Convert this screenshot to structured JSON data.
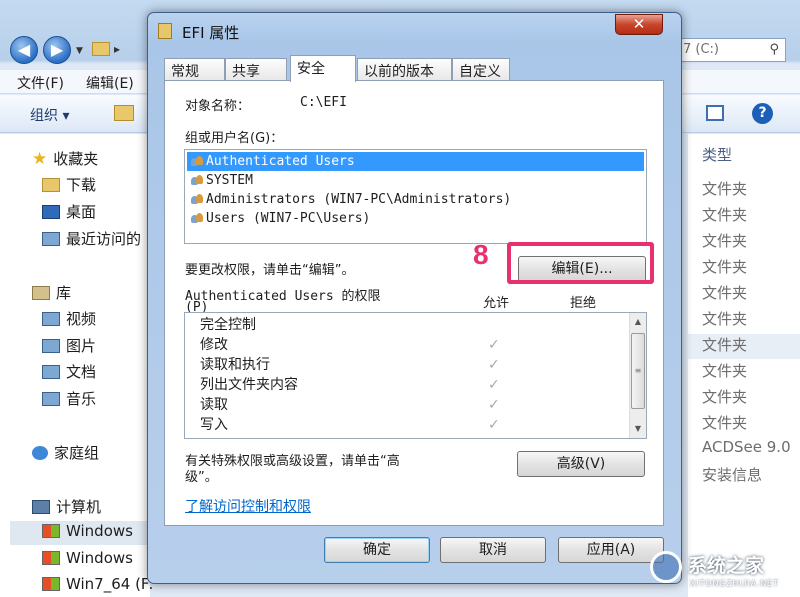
{
  "explorer": {
    "address_tail": "▸",
    "search_box_text": "7 (C:)",
    "menu": [
      "文件(F)",
      "编辑(E)"
    ],
    "toolbar": {
      "organize_label": "组织 ▾"
    },
    "tree": {
      "favorites": "收藏夹",
      "downloads": "下载",
      "desktop": "桌面",
      "recent": "最近访问的",
      "libraries": "库",
      "videos": "视频",
      "pictures": "图片",
      "documents": "文档",
      "music": "音乐",
      "homegroup": "家庭组",
      "computer": "计算机",
      "windows_1": "Windows",
      "windows_2": "Windows",
      "win7_64": "Win7_64 (F:"
    },
    "column_type": "类型",
    "types": [
      "文件夹",
      "文件夹",
      "文件夹",
      "文件夹",
      "文件夹",
      "文件夹",
      "文件夹",
      "文件夹",
      "文件夹",
      "文件夹",
      "ACDSee 9.0",
      "安装信息"
    ]
  },
  "dialog": {
    "title": "EFI 属性",
    "close_glyph": "✕",
    "tabs": [
      "常规",
      "共享",
      "安全",
      "以前的版本",
      "自定义"
    ],
    "object_name_label": "对象名称：",
    "object_name_value": "C:\\EFI",
    "group_label": "组或用户名(G)：",
    "users": [
      "Authenticated Users",
      "SYSTEM",
      "Administrators (WIN7-PC\\Administrators)",
      "Users (WIN7-PC\\Users)"
    ],
    "edit_hint": "要更改权限，请单击“编辑”。",
    "edit_button": "编辑(E)...",
    "step_number": "8",
    "perm_title_line1": "Authenticated Users 的权限",
    "perm_title_line2": "(P)",
    "allow_header": "允许",
    "deny_header": "拒绝",
    "permissions": [
      "完全控制",
      "修改",
      "读取和执行",
      "列出文件夹内容",
      "读取",
      "写入"
    ],
    "check_glyph": "✓",
    "advanced_hint_line1": "有关特殊权限或高级设置，请单击“高",
    "advanced_hint_line2": "级”。",
    "advanced_button": "高级(V)",
    "learn_link": "了解访问控制和权限",
    "ok_button": "确定",
    "cancel_button": "取消",
    "apply_button": "应用(A)"
  },
  "watermark": {
    "text": "系统之家",
    "sub": "XITONGZHIJIA.NET"
  },
  "colors": {
    "highlight": "#e8306e",
    "selection": "#3399ff",
    "link": "#0066cc"
  }
}
